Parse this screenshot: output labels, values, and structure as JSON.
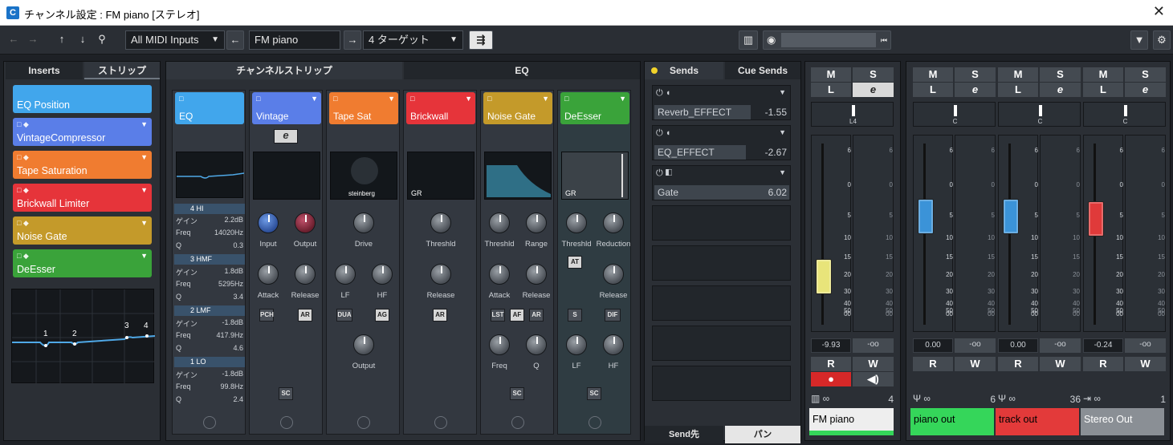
{
  "window": {
    "title": "チャンネル設定 : FM piano [ステレオ]"
  },
  "toolbar": {
    "midi_input": "All MIDI Inputs",
    "channel_name": "FM piano",
    "target": "4 ターゲット"
  },
  "left": {
    "tab_inserts": "Inserts",
    "tab_strip": "ストリップ",
    "slots": [
      {
        "label": "EQ Position"
      },
      {
        "label": "VintageCompressor"
      },
      {
        "label": "Tape Saturation"
      },
      {
        "label": "Brickwall Limiter"
      },
      {
        "label": "Noise Gate"
      },
      {
        "label": "DeEsser"
      }
    ],
    "graph_points": [
      "1",
      "2",
      "3",
      "4"
    ]
  },
  "strip": {
    "title": "チャンネルストリップ",
    "eq_title": "EQ",
    "modules": [
      {
        "name": "EQ",
        "color": "#41a6ec"
      },
      {
        "name": "Vintage",
        "color": "#5a7ee8",
        "e": "e",
        "knobs": [
          "Input",
          "Output",
          "Attack",
          "Release"
        ],
        "btns": [
          "PCH",
          "AR"
        ]
      },
      {
        "name": "Tape Sat",
        "color": "#f07c30",
        "brand": "steinberg",
        "knobs": [
          "Drive",
          "LF",
          "HF",
          "Output"
        ],
        "btns": [
          "DUA",
          "AG"
        ]
      },
      {
        "name": "Brickwall",
        "color": "#e6343a",
        "knobs": [
          "Threshld",
          "Release"
        ],
        "btns": [
          "AR"
        ],
        "gr": "GR"
      },
      {
        "name": "Noise Gate",
        "color": "#c49a2a",
        "knobs": [
          "Threshld",
          "Range",
          "Attack",
          "Release",
          "Freq",
          "Q"
        ],
        "btns": [
          "LST",
          "AF",
          "AR"
        ]
      },
      {
        "name": "DeEsser",
        "color": "#3aa33a",
        "knobs": [
          "Threshld",
          "Reduction",
          "Release",
          "LF",
          "HF"
        ],
        "btns": [
          "AT",
          "S",
          "DIF"
        ],
        "gr": "GR"
      }
    ],
    "sc": "SC",
    "eq_bands": [
      {
        "name": "4 HI",
        "gain": "2.2dB",
        "freq": "14020Hz",
        "q": "0.3"
      },
      {
        "name": "3 HMF",
        "gain": "1.8dB",
        "freq": "5295Hz",
        "q": "3.4"
      },
      {
        "name": "2 LMF",
        "gain": "-1.8dB",
        "freq": "417.9Hz",
        "q": "4.6"
      },
      {
        "name": "1 LO",
        "gain": "-1.8dB",
        "freq": "99.8Hz",
        "q": "2.4"
      }
    ],
    "eq_labels": {
      "gain": "ゲイン",
      "freq": "Freq",
      "q": "Q"
    }
  },
  "sends": {
    "tab_sends": "Sends",
    "tab_cue": "Cue Sends",
    "items": [
      {
        "name": "Reverb_EFFECT",
        "value": "-1.55"
      },
      {
        "name": "EQ_EFFECT",
        "value": "-2.67"
      },
      {
        "name": "Gate",
        "value": "6.02"
      }
    ],
    "bottom_send": "Send先",
    "bottom_pan": "パン"
  },
  "faders": {
    "scale": [
      "6",
      "0",
      "5",
      "10",
      "15",
      "20",
      "30",
      "40",
      "00",
      "50"
    ],
    "ms": {
      "m": "M",
      "s": "S",
      "l": "L",
      "e": "e",
      "r": "R",
      "w": "W"
    },
    "channels": [
      {
        "pan": "L4",
        "level": "-9.93",
        "peak": "-oo",
        "num": "4",
        "name": "FM piano",
        "color": "#eeeeee",
        "text": "#000",
        "cap": "#e8e47a",
        "pos": 0.66
      },
      {
        "pan": "C",
        "level": "0.00",
        "peak": "-oo",
        "num": "6",
        "name": "piano out",
        "color": "#35d65a",
        "text": "#000",
        "cap": "#3b93d8",
        "pos": 0.32
      },
      {
        "pan": "C",
        "level": "0.00",
        "peak": "-oo",
        "num": "36",
        "name": "track out",
        "color": "#e33a3a",
        "text": "#000",
        "cap": "#3b93d8",
        "pos": 0.32
      },
      {
        "pan": "C",
        "level": "-0.24",
        "peak": "-oo",
        "num": "1",
        "name": "Stereo Out",
        "color": "#8a8f95",
        "text": "#fff",
        "cap": "#e03a3a",
        "pos": 0.33
      }
    ]
  }
}
